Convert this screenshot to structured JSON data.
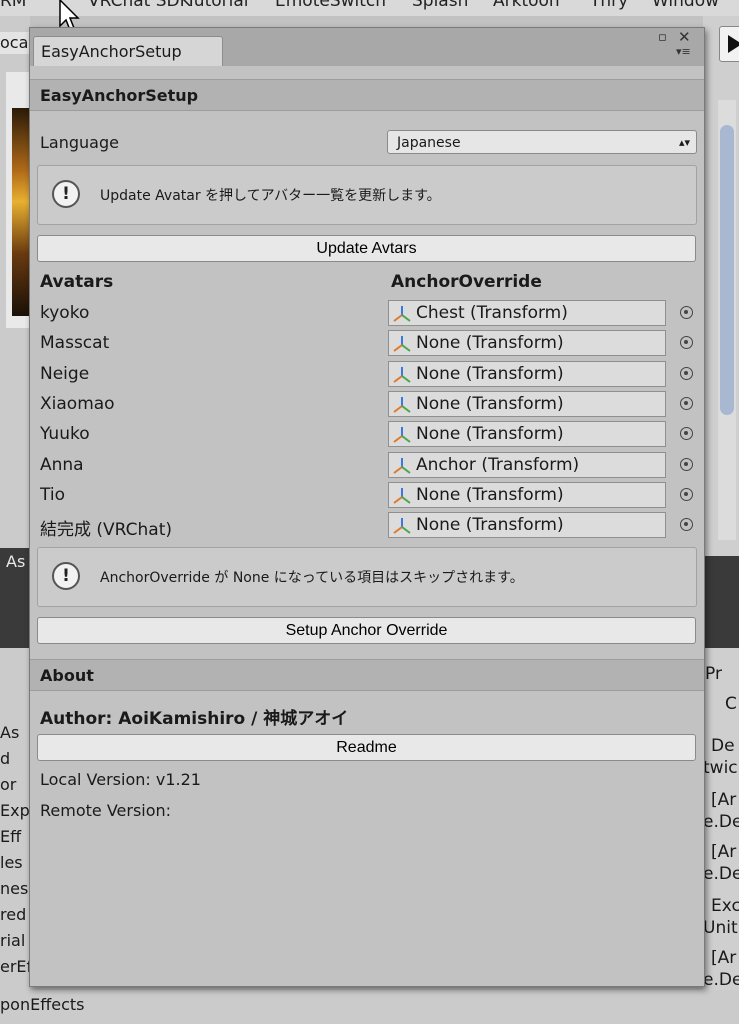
{
  "editor": {
    "menu": [
      "RM",
      "VRChat SDK",
      "Tutorial",
      "EmoteSwitch",
      "Splash",
      "Arktoon",
      "Thry",
      "Window"
    ],
    "left_tab": "ocal",
    "left_dark_label": "As",
    "left_list": [
      "As",
      "d",
      "or",
      "Expl",
      "Eff",
      "les",
      "nes",
      "red",
      "rial",
      "erEf"
    ],
    "right_texts": [
      "Pr",
      "C",
      "De",
      "twic",
      "[Ar",
      "e.De",
      "[Ar",
      "e.De",
      "Exc",
      "Unit",
      "[Ar",
      "e.De"
    ],
    "bottom_text": "ponEffects"
  },
  "window": {
    "tab_title": "EasyAnchorSetup",
    "header": "EasyAnchorSetup",
    "language": {
      "label": "Language",
      "value": "Japanese"
    },
    "help1": "Update Avatar を押してアバター一覧を更新します。",
    "update_button": "Update Avtars",
    "columns": {
      "avatars": "Avatars",
      "anchor": "AnchorOverride"
    },
    "rows": [
      {
        "name": "kyoko",
        "value": "Chest (Transform)"
      },
      {
        "name": "Masscat",
        "value": "None (Transform)"
      },
      {
        "name": "Neige",
        "value": "None (Transform)"
      },
      {
        "name": "Xiaomao",
        "value": "None (Transform)"
      },
      {
        "name": "Yuuko",
        "value": "None (Transform)"
      },
      {
        "name": "Anna",
        "value": "Anchor (Transform)"
      },
      {
        "name": "Tio",
        "value": "None (Transform)"
      },
      {
        "name": "結完成 (VRChat)",
        "value": "None (Transform)"
      }
    ],
    "help2": "AnchorOverride が None になっている項目はスキップされます。",
    "setup_button": "Setup Anchor Override",
    "about": {
      "header": "About",
      "author": "Author: AoiKamishiro / 神城アオイ",
      "readme_button": "Readme",
      "local_version": "Local Version: v1.21",
      "remote_version": "Remote Version:"
    }
  }
}
